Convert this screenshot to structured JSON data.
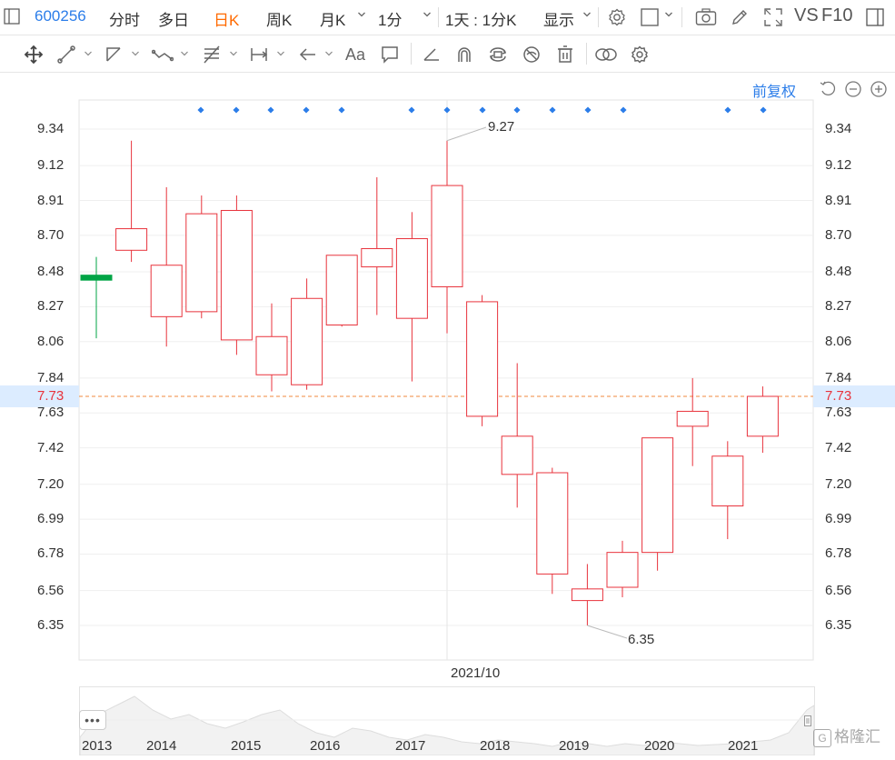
{
  "toolbar": {
    "code": "600256",
    "tabs": [
      "分时",
      "多日",
      "日K",
      "周K",
      "月K",
      "1分"
    ],
    "active_tab": "日K",
    "period_select": "1天 : 1分K",
    "display_select": "显示",
    "vs_label": "VS",
    "f10_label": "F10"
  },
  "drawing_tools": [
    "move-icon",
    "line-icon",
    "ray-icon",
    "polyline-icon",
    "fib-icon",
    "range-icon",
    "arrow-icon",
    "text-tool-icon",
    "comment-icon",
    "ruler-icon",
    "magnet-icon",
    "lock-icon",
    "hide-icon",
    "trash-icon",
    "link-icon",
    "settings-icon"
  ],
  "text_tool_label": "Aa",
  "controls": {
    "adjust_label": "前复权"
  },
  "chart_data": {
    "type": "candlestick",
    "y_ticks": [
      "9.34",
      "9.12",
      "8.91",
      "8.70",
      "8.48",
      "8.27",
      "8.06",
      "7.84",
      "7.63",
      "7.42",
      "7.20",
      "6.99",
      "6.78",
      "6.56",
      "6.35"
    ],
    "ylim": [
      6.35,
      9.34
    ],
    "current_price": "7.73",
    "x_axis_label": "2021/10",
    "max_label": "9.27",
    "min_label": "6.35",
    "candles": [
      {
        "o": 8.46,
        "c": 8.43,
        "h": 8.57,
        "l": 8.08
      },
      {
        "o": 8.61,
        "c": 8.74,
        "h": 9.27,
        "l": 8.54
      },
      {
        "o": 8.21,
        "c": 8.52,
        "h": 8.99,
        "l": 8.03
      },
      {
        "o": 8.24,
        "c": 8.83,
        "h": 8.94,
        "l": 8.2
      },
      {
        "o": 8.07,
        "c": 8.85,
        "h": 8.94,
        "l": 7.98
      },
      {
        "o": 7.86,
        "c": 8.09,
        "h": 8.29,
        "l": 7.76
      },
      {
        "o": 7.8,
        "c": 8.32,
        "h": 8.44,
        "l": 7.77
      },
      {
        "o": 8.16,
        "c": 8.58,
        "h": 8.58,
        "l": 8.15
      },
      {
        "o": 8.51,
        "c": 8.62,
        "h": 9.05,
        "l": 8.22
      },
      {
        "o": 8.2,
        "c": 8.68,
        "h": 8.84,
        "l": 7.82
      },
      {
        "o": 8.39,
        "c": 9.0,
        "h": 9.27,
        "l": 8.11
      },
      {
        "o": 7.61,
        "c": 8.3,
        "h": 8.34,
        "l": 7.55
      },
      {
        "o": 7.26,
        "c": 7.49,
        "h": 7.93,
        "l": 7.06
      },
      {
        "o": 6.66,
        "c": 7.27,
        "h": 7.3,
        "l": 6.54
      },
      {
        "o": 6.5,
        "c": 6.57,
        "h": 6.72,
        "l": 6.35
      },
      {
        "o": 6.58,
        "c": 6.79,
        "h": 6.86,
        "l": 6.52
      },
      {
        "o": 6.79,
        "c": 7.48,
        "h": 7.48,
        "l": 6.68
      },
      {
        "o": 7.55,
        "c": 7.64,
        "h": 7.84,
        "l": 7.31
      },
      {
        "o": 7.07,
        "c": 7.37,
        "h": 7.46,
        "l": 6.87
      },
      {
        "o": 7.49,
        "c": 7.73,
        "h": 7.79,
        "l": 7.39
      }
    ],
    "markers": [
      3,
      4,
      5,
      6,
      7,
      9,
      10,
      11,
      12,
      13,
      14,
      15,
      18,
      19
    ]
  },
  "navigator": {
    "years": [
      "2013",
      "2014",
      "2015",
      "2016",
      "2017",
      "2018",
      "2019",
      "2020",
      "2021"
    ],
    "more_label": "•••"
  },
  "colors": {
    "up": "#e8333c",
    "down": "#00a445",
    "accent": "#2b7de9",
    "active_tab": "#ff6a00",
    "price_line": "#f08a3c"
  },
  "watermark": "格隆汇"
}
